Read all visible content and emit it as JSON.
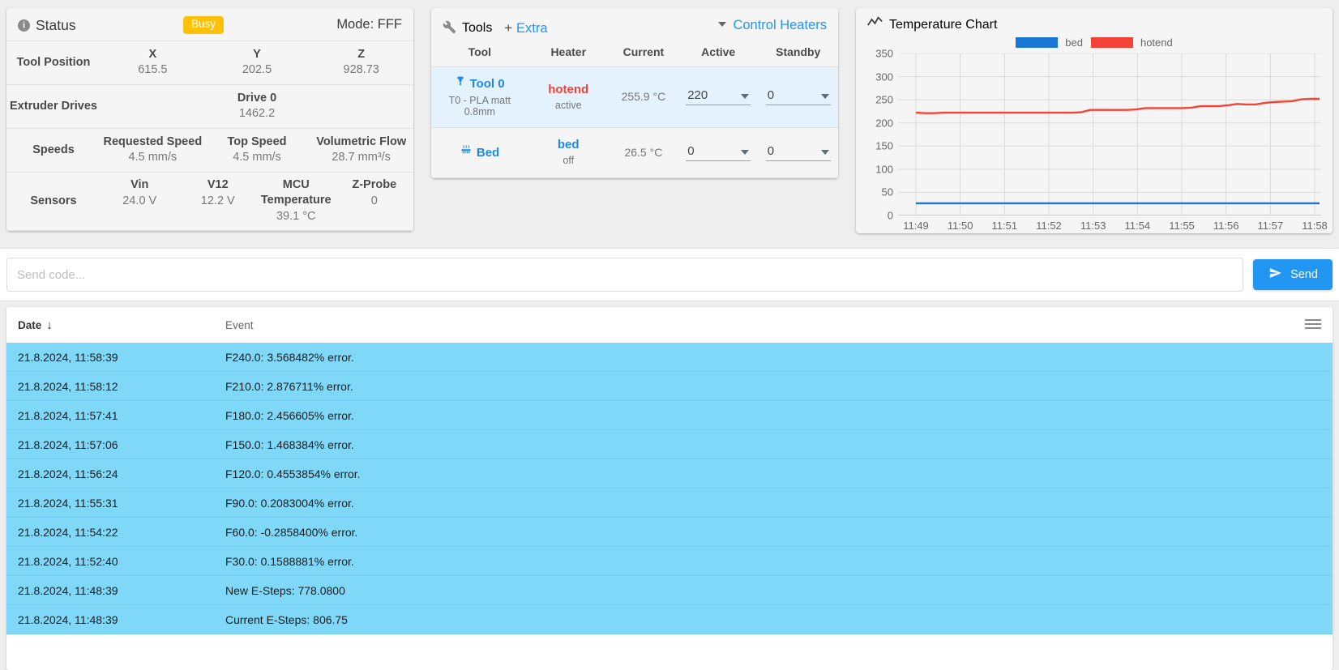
{
  "status": {
    "title": "Status",
    "icon": "info-icon",
    "badge": "Busy",
    "badge_color": "#ffc107",
    "mode": "Mode: FFF",
    "rows": [
      {
        "label": "Tool Position",
        "cells": [
          {
            "k": "X",
            "v": "615.5"
          },
          {
            "k": "Y",
            "v": "202.5"
          },
          {
            "k": "Z",
            "v": "928.73"
          }
        ]
      },
      {
        "label": "Extruder Drives",
        "cells": [
          {
            "k": "Drive 0",
            "v": "1462.2"
          }
        ]
      },
      {
        "label": "Speeds",
        "cells": [
          {
            "k": "Requested Speed",
            "v": "4.5 mm/s"
          },
          {
            "k": "Top Speed",
            "v": "4.5 mm/s"
          },
          {
            "k": "Volumetric Flow",
            "v": "28.7 mm³/s"
          }
        ]
      },
      {
        "label": "Sensors",
        "cells": [
          {
            "k": "Vin",
            "v": "24.0 V"
          },
          {
            "k": "V12",
            "v": "12.2 V"
          },
          {
            "k": "MCU Temperature",
            "v": "39.1 °C"
          },
          {
            "k": "Z-Probe",
            "v": "0"
          }
        ]
      }
    ]
  },
  "tools": {
    "title": "Tools",
    "icon": "wrench-icon",
    "plus": "+",
    "extra_label": "Extra",
    "control_heaters_label": "Control Heaters",
    "columns": [
      "Tool",
      "Heater",
      "Current",
      "Active",
      "Standby"
    ],
    "rows": [
      {
        "tool_name": "Tool 0",
        "tool_icon": "nozzle-icon",
        "tool_sub": "T0 - PLA matt 0.8mm",
        "heater": "hotend",
        "heater_color": "#f44336",
        "heater_state": "active",
        "current": "255.9 °C",
        "active": "220",
        "standby": "0",
        "selected": true
      },
      {
        "tool_name": "Bed",
        "tool_icon": "heated-bed-icon",
        "tool_sub": "",
        "heater": "bed",
        "heater_color": "#1e88e5",
        "heater_state": "off",
        "current": "26.5 °C",
        "active": "0",
        "standby": "0",
        "selected": false
      }
    ]
  },
  "chart": {
    "title": "Temperature Chart",
    "icon": "line-chart-icon"
  },
  "chart_data": {
    "type": "line",
    "title": "Temperature Chart",
    "xlabel": "",
    "ylabel": "",
    "grid": true,
    "legend_position": "top-center",
    "ylim": [
      0,
      350
    ],
    "yticks": [
      0,
      50,
      100,
      150,
      200,
      250,
      300,
      350
    ],
    "xticks": [
      "11:49",
      "11:50",
      "11:51",
      "11:52",
      "11:53",
      "11:54",
      "11:55",
      "11:56",
      "11:57",
      "11:58"
    ],
    "series": [
      {
        "name": "bed",
        "color": "#1976d2",
        "values": [
          26.5,
          26.5,
          26.5,
          26.5,
          26.5,
          26.5,
          26.5,
          26.5,
          26.5,
          26.5,
          26.5,
          26.5,
          26.5,
          26.5,
          26.5,
          26.5,
          26.5,
          26.5,
          26.5,
          26.5,
          26.5,
          26.5,
          26.5,
          26.5,
          26.5,
          26.5,
          26.5,
          26.5,
          26.5,
          26.5,
          26.5,
          26.5,
          26.5,
          26.5,
          26.5,
          26.5,
          26.5,
          26.5,
          26.5,
          26.5
        ]
      },
      {
        "name": "hotend",
        "color": "#f44336",
        "values": [
          222,
          221,
          221,
          222,
          222,
          222,
          222,
          222,
          222,
          222,
          222,
          222,
          222,
          222,
          222,
          222,
          222,
          222,
          223,
          228,
          228,
          228,
          228,
          228,
          229,
          232,
          232,
          232,
          232,
          232,
          233,
          236,
          236,
          236,
          238,
          241,
          240,
          240,
          243,
          245,
          246,
          247,
          251,
          252,
          252
        ]
      }
    ]
  },
  "console": {
    "placeholder": "Send code...",
    "value": "",
    "send_label": "Send",
    "send_icon": "paper-plane-icon",
    "send_color": "#2196f3"
  },
  "log": {
    "col_date": "Date",
    "col_event": "Event",
    "sort_icon": "arrow-down-icon",
    "menu_icon": "hamburger-icon",
    "row_color": "#7fd8f7",
    "rows": [
      {
        "date": "21.8.2024, 11:58:39",
        "event": "F240.0: 3.568482% error."
      },
      {
        "date": "21.8.2024, 11:58:12",
        "event": "F210.0: 2.876711% error."
      },
      {
        "date": "21.8.2024, 11:57:41",
        "event": "F180.0: 2.456605% error."
      },
      {
        "date": "21.8.2024, 11:57:06",
        "event": "F150.0: 1.468384% error."
      },
      {
        "date": "21.8.2024, 11:56:24",
        "event": "F120.0: 0.4553854% error."
      },
      {
        "date": "21.8.2024, 11:55:31",
        "event": "F90.0: 0.2083004% error."
      },
      {
        "date": "21.8.2024, 11:54:22",
        "event": "F60.0: -0.2858400% error."
      },
      {
        "date": "21.8.2024, 11:52:40",
        "event": "F30.0: 0.1588881% error."
      },
      {
        "date": "21.8.2024, 11:48:39",
        "event": "New E-Steps: 778.0800"
      },
      {
        "date": "21.8.2024, 11:48:39",
        "event": "Current E-Steps: 806.75"
      }
    ]
  }
}
